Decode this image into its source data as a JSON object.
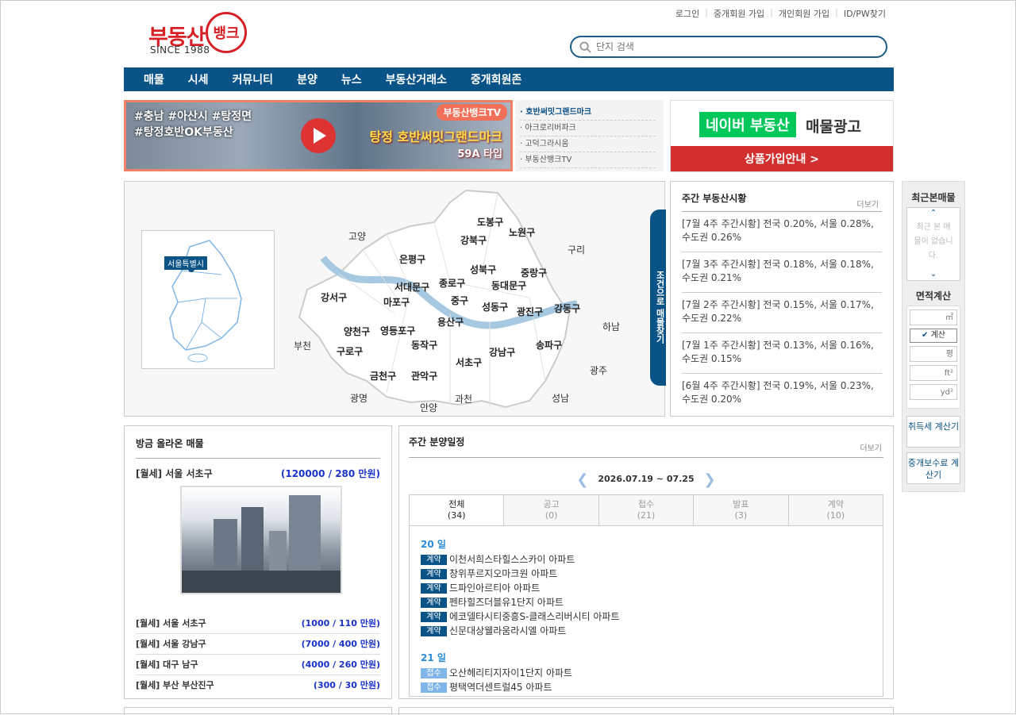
{
  "top_links": [
    "로그인",
    "중개회원 가입",
    "개인회원 가입",
    "ID/PW찾기"
  ],
  "logo": {
    "brand": "부동산",
    "circle": "뱅크",
    "since": "SINCE 1988"
  },
  "search": {
    "placeholder": "단지 검색"
  },
  "nav": [
    "매물",
    "시세",
    "커뮤니티",
    "분양",
    "뉴스",
    "부동산거래소",
    "중개회원존"
  ],
  "banner": {
    "hashtags_line1": "#충남 #아산시 #탕정면",
    "hashtags_line2": "#탕정호반OK부동산",
    "channel": "부동산뱅크TV",
    "title": "탕정 호반써밋그랜드마크",
    "subtitle": "59A 타입"
  },
  "tv_list": [
    "호반써밋그랜드마크",
    "아크로리버파크",
    "고덕그라시움",
    "부동산뱅크TV"
  ],
  "naver_ad": {
    "brand": "네이버 부동산",
    "label": "매물광고",
    "cta": "상품가입안내 >"
  },
  "map": {
    "mini_label": "서울특별시",
    "condition_tab": "조건으로 매물찾기",
    "outer_regions": [
      "고양",
      "구리",
      "하남",
      "부천",
      "광주",
      "광명",
      "안양",
      "과천",
      "성남"
    ],
    "districts": [
      "도봉구",
      "노원구",
      "강북구",
      "은평구",
      "성북구",
      "중랑구",
      "종로구",
      "서대문구",
      "동대문구",
      "마포구",
      "중구",
      "강서구",
      "성동구",
      "광진구",
      "강동구",
      "용산구",
      "양천구",
      "영등포구",
      "구로구",
      "동작구",
      "송파구",
      "강남구",
      "서초구",
      "금천구",
      "관악구"
    ]
  },
  "market": {
    "title": "주간 부동산시황",
    "more": "더보기",
    "items": [
      "[7월 4주 주간시황] 전국 0.20%, 서울 0.28%, 수도권 0.26%",
      "[7월 3주 주간시황] 전국 0.18%, 서울 0.18%, 수도권 0.21%",
      "[7월 2주 주간시황] 전국 0.15%, 서울 0.17%, 수도권 0.22%",
      "[7월 1주 주간시황] 전국 0.13%, 서울 0.16%, 수도권 0.15%",
      "[6월 4주 주간시황] 전국 0.19%, 서울 0.23%, 수도권 0.20%"
    ]
  },
  "side": {
    "recent_title": "최근본매물",
    "recent_empty": "최근 본 매물이 없습니다.",
    "area_title": "면적계산",
    "units": [
      "㎡",
      "평",
      "ft²",
      "yd²"
    ],
    "calc_btn": "계산",
    "tax_btn": "취득세 계산기",
    "fee_btn": "중개보수료 계산기"
  },
  "recent_listings": {
    "title": "방금 올라온 매물",
    "main": {
      "label": "[월세] 서울 서초구",
      "price": "(120000 / 280 만원)"
    },
    "rows": [
      {
        "label": "[월세] 서울 서초구",
        "price": "(1000 / 110 만원)"
      },
      {
        "label": "[월세] 서울 강남구",
        "price": "(7000 / 400 만원)"
      },
      {
        "label": "[월세] 대구 남구",
        "price": "(4000 / 260 만원)"
      },
      {
        "label": "[월세] 부산 부산진구",
        "price": "(300 / 30 만원)"
      }
    ]
  },
  "schedule": {
    "title": "주간 분양일정",
    "more": "더보기",
    "week": "2026.07.19 ~ 07.25",
    "tabs": [
      {
        "name": "전체",
        "count": "(34)"
      },
      {
        "name": "공고",
        "count": "(0)"
      },
      {
        "name": "접수",
        "count": "(21)"
      },
      {
        "name": "발표",
        "count": "(3)"
      },
      {
        "name": "계약",
        "count": "(10)"
      }
    ],
    "days": [
      {
        "day": "20 일",
        "events": [
          {
            "tag": "계약",
            "name": "이천서희스타힐스스카이 아파트"
          },
          {
            "tag": "계약",
            "name": "창위푸르지오마크원 아파트"
          },
          {
            "tag": "계약",
            "name": "드파인아르티아 아파트"
          },
          {
            "tag": "계약",
            "name": "펜타힐즈더블유1단지 아파트"
          },
          {
            "tag": "계약",
            "name": "에코델타시티중흥S-클래스리버시티 아파트"
          },
          {
            "tag": "계약",
            "name": "신문대상웰라움라시엘 아파트"
          }
        ]
      },
      {
        "day": "21 일",
        "events": [
          {
            "tag": "접수",
            "name": "오산헤리티지자이1단지 아파트"
          },
          {
            "tag": "접수",
            "name": "평택역더센트럴45 아파트"
          }
        ]
      }
    ]
  },
  "colors": {
    "brand_red": "#d71f26",
    "nav_blue": "#0a5387",
    "naver_green": "#03c75a",
    "price_blue": "#1a33c8"
  }
}
